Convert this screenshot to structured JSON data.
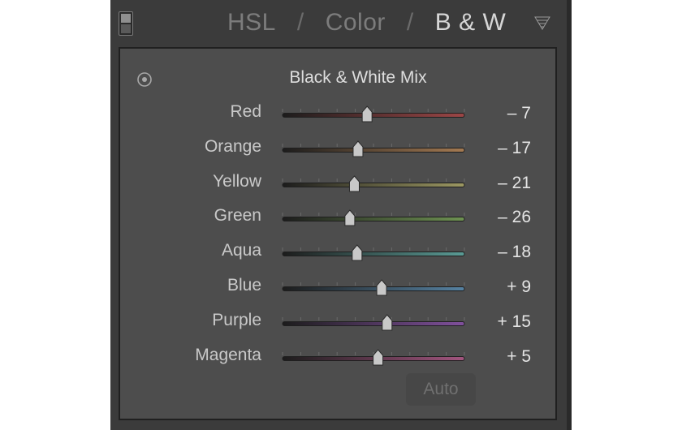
{
  "header": {
    "tabs": [
      {
        "label": "HSL",
        "active": false
      },
      {
        "label": "Color",
        "active": false
      },
      {
        "label": "B & W",
        "active": true
      }
    ],
    "separator": "/",
    "toggle_icon": "panel-solo-toggle-icon",
    "menu_icon": "panel-menu-triangle-icon"
  },
  "panel": {
    "title": "Black & White Mix",
    "target_icon": "targeted-adjustment-icon",
    "auto_label": "Auto",
    "slider_range": [
      -100,
      100
    ],
    "sliders": [
      {
        "label": "Red",
        "value": -7,
        "display": "– 7",
        "color": "#9c4646"
      },
      {
        "label": "Orange",
        "value": -17,
        "display": "– 17",
        "color": "#a47a52"
      },
      {
        "label": "Yellow",
        "value": -21,
        "display": "– 21",
        "color": "#9c9862"
      },
      {
        "label": "Green",
        "value": -26,
        "display": "– 26",
        "color": "#6e9252"
      },
      {
        "label": "Aqua",
        "value": -18,
        "display": "– 18",
        "color": "#5a9b95"
      },
      {
        "label": "Blue",
        "value": 9,
        "display": "+ 9",
        "color": "#5682a2"
      },
      {
        "label": "Purple",
        "value": 15,
        "display": "+ 15",
        "color": "#80509c"
      },
      {
        "label": "Magenta",
        "value": 5,
        "display": "+ 5",
        "color": "#a2557f"
      }
    ]
  }
}
